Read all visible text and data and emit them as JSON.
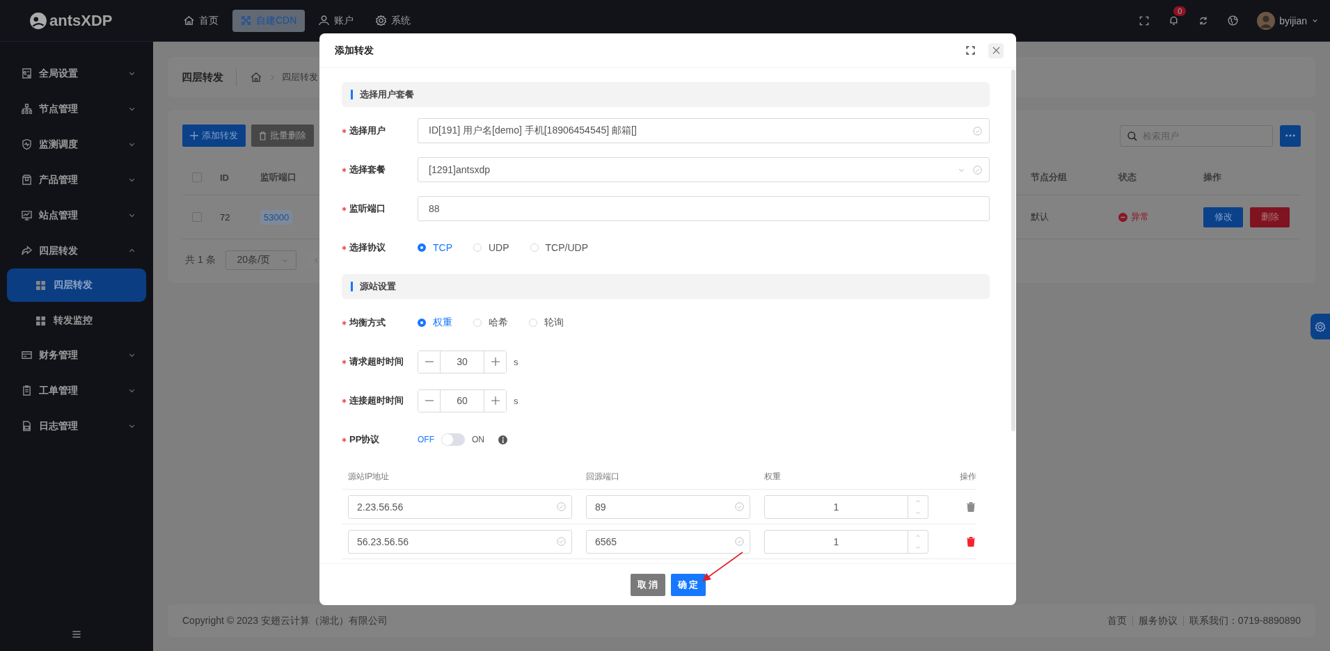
{
  "header": {
    "logo": "antsXDP",
    "nav": [
      {
        "label": "首页",
        "selected": false
      },
      {
        "label": "自建CDN",
        "selected": true
      },
      {
        "label": "账户",
        "selected": false
      },
      {
        "label": "系统",
        "selected": false
      }
    ],
    "notification_count": "0",
    "user": "byijian"
  },
  "sidebar": {
    "items": [
      {
        "label": "全局设置",
        "expanded": false
      },
      {
        "label": "节点管理",
        "expanded": false
      },
      {
        "label": "监测调度",
        "expanded": false
      },
      {
        "label": "产品管理",
        "expanded": false
      },
      {
        "label": "站点管理",
        "expanded": false
      },
      {
        "label": "四层转发",
        "expanded": true,
        "children": [
          {
            "label": "四层转发",
            "selected": true
          },
          {
            "label": "转发监控",
            "selected": false
          }
        ]
      },
      {
        "label": "财务管理",
        "expanded": false
      },
      {
        "label": "工单管理",
        "expanded": false
      },
      {
        "label": "日志管理",
        "expanded": false
      }
    ]
  },
  "page": {
    "title": "四层转发",
    "breadcrumb": [
      "四层转发"
    ],
    "toolbar": {
      "buttons": [
        {
          "label": "添加转发",
          "kind": "primary"
        },
        {
          "label": "批量删除",
          "kind": "secondary"
        }
      ],
      "search": {
        "placeholder": "检索用户"
      }
    },
    "table": {
      "header_checked": false,
      "columns_left": [
        "ID",
        "监听端口"
      ],
      "columns_right": [
        "节点分组",
        "状态",
        "操作"
      ],
      "rows": [
        {
          "checked": false,
          "id": "72",
          "port": "53000",
          "group": "默认",
          "status": "异常",
          "actions": [
            {
              "label": "修改",
              "kind": "edit"
            },
            {
              "label": "删除",
              "kind": "delete"
            }
          ]
        }
      ]
    },
    "pagination": {
      "total": "共 1 条",
      "page_size": "20条/页"
    }
  },
  "footer": {
    "copyright": "Copyright © 2023 安翅云计算（湖北）有限公司",
    "links": [
      "首页",
      "服务协议",
      "联系我们：0719-8890890"
    ]
  },
  "modal": {
    "title": "添加转发",
    "sections": [
      {
        "title": "选择用户套餐",
        "fields": [
          {
            "kind": "input",
            "label": "选择用户",
            "required": true,
            "value": "ID[191] 用户名[demo] 手机[18906454545] 邮箱[]",
            "validated": true
          },
          {
            "kind": "select",
            "label": "选择套餐",
            "required": true,
            "value": "[1291]antsxdp",
            "validated": true
          },
          {
            "kind": "input",
            "label": "监听端口",
            "required": true,
            "value": "88",
            "validated": false
          },
          {
            "kind": "radio",
            "label": "选择协议",
            "required": true,
            "options": [
              {
                "label": "TCP",
                "selected": true
              },
              {
                "label": "UDP",
                "selected": false
              },
              {
                "label": "TCP/UDP",
                "selected": false
              }
            ]
          }
        ]
      },
      {
        "title": "源站设置",
        "fields": [
          {
            "kind": "radio",
            "label": "均衡方式",
            "required": true,
            "options": [
              {
                "label": "权重",
                "selected": true
              },
              {
                "label": "哈希",
                "selected": false
              },
              {
                "label": "轮询",
                "selected": false
              }
            ]
          },
          {
            "kind": "stepper",
            "label": "请求超时时间",
            "required": true,
            "value": "30",
            "unit": "s"
          },
          {
            "kind": "stepper",
            "label": "连接超时时间",
            "required": true,
            "value": "60",
            "unit": "s"
          },
          {
            "kind": "toggle",
            "label": "PP协议",
            "required": true,
            "on": false,
            "off_label": "OFF",
            "on_label": "ON"
          }
        ]
      }
    ],
    "origin_table": {
      "columns": [
        "源站IP地址",
        "回源端口",
        "权重",
        "操作"
      ],
      "rows": [
        {
          "ip": "2.23.56.56",
          "port": "89",
          "weight": "1",
          "deletable": false
        },
        {
          "ip": "56.23.56.56",
          "port": "6565",
          "weight": "1",
          "deletable": true
        }
      ]
    },
    "buttons": [
      {
        "label": "取 消",
        "kind": "cancel"
      },
      {
        "label": "确 定",
        "kind": "primary"
      }
    ]
  }
}
